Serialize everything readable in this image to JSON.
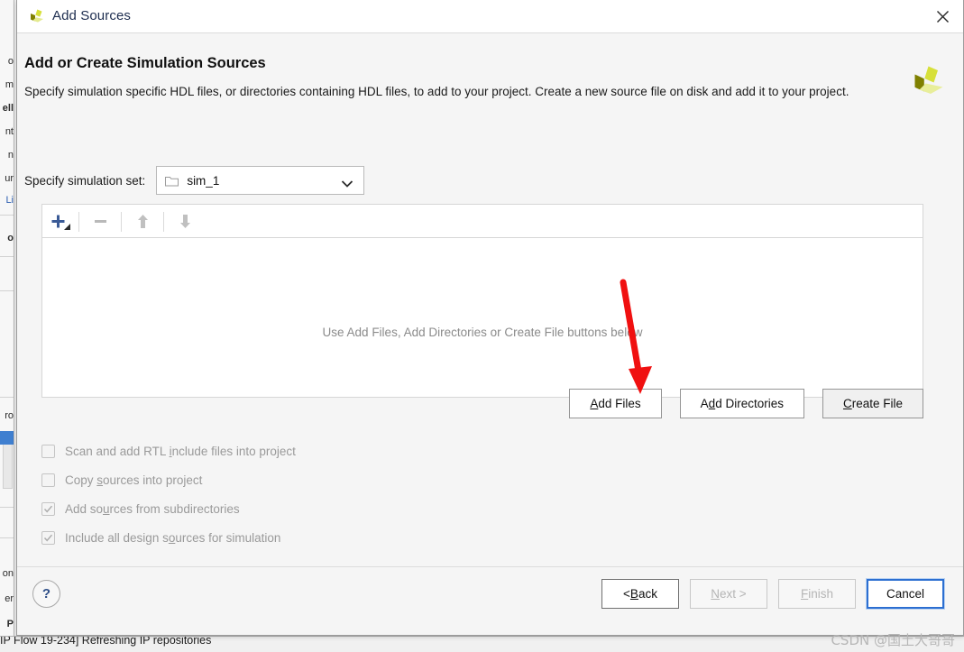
{
  "dialog": {
    "title": "Add Sources",
    "title_icon": "xilinx-logo-icon",
    "close_icon": "close-icon",
    "brand_logo": "amd-xilinx-logo"
  },
  "header": {
    "page_title": "Add or Create Simulation Sources",
    "description": "Specify simulation specific HDL files, or directories containing HDL files, to add to your project. Create a new source file on disk and add it to your project."
  },
  "sim_set": {
    "label": "Specify simulation set:",
    "value": "sim_1",
    "folder_icon": "folder-icon",
    "caret_icon": "chevron-down-icon",
    "options": [
      "sim_1"
    ]
  },
  "toolbar": {
    "buttons": [
      {
        "name": "add-sources-button",
        "icon": "plus-icon",
        "enabled": true,
        "has_dropdown": true
      },
      {
        "name": "remove-sources-button",
        "icon": "minus-icon",
        "enabled": false
      },
      {
        "name": "move-up-button",
        "icon": "arrow-up-icon",
        "enabled": false
      },
      {
        "name": "move-down-button",
        "icon": "arrow-down-icon",
        "enabled": false
      }
    ]
  },
  "source_list": {
    "empty_hint": "Use Add Files, Add Directories or Create File buttons below",
    "items": []
  },
  "source_buttons": [
    {
      "name": "add-files-button",
      "pre": "",
      "mnemonic": "A",
      "post": "dd Files",
      "hover": false
    },
    {
      "name": "add-directories-button",
      "pre": "A",
      "mnemonic": "d",
      "post": "d Directories",
      "hover": false
    },
    {
      "name": "create-file-button",
      "pre": "",
      "mnemonic": "C",
      "post": "reate File",
      "hover": true
    }
  ],
  "options": [
    {
      "name": "scan-rtl-include-checkbox",
      "pre": "Scan and add RTL ",
      "mnemonic": "i",
      "post": "nclude files into project",
      "checked": false,
      "enabled": false
    },
    {
      "name": "copy-sources-checkbox",
      "pre": "Copy ",
      "mnemonic": "s",
      "post": "ources into project",
      "checked": false,
      "enabled": false
    },
    {
      "name": "add-subdirectories-checkbox",
      "pre": "Add so",
      "mnemonic": "u",
      "post": "rces from subdirectories",
      "checked": true,
      "enabled": false
    },
    {
      "name": "include-all-design-sources-checkbox",
      "pre": "Include all design s",
      "mnemonic": "o",
      "post": "urces for simulation",
      "checked": true,
      "enabled": false
    }
  ],
  "footer": {
    "help_label": "?",
    "buttons": [
      {
        "name": "back-button",
        "pre": "< ",
        "mnemonic": "B",
        "post": "ack",
        "state": "enabled"
      },
      {
        "name": "next-button",
        "pre": "",
        "mnemonic": "N",
        "post": "ext >",
        "state": "disabled"
      },
      {
        "name": "finish-button",
        "pre": "",
        "mnemonic": "F",
        "post": "inish",
        "state": "disabled"
      },
      {
        "name": "cancel-button",
        "pre": "",
        "mnemonic": "",
        "post": "Cancel",
        "state": "focused"
      }
    ]
  },
  "annotation": {
    "arrow_color": "#f01010",
    "points_to": "create-file-button"
  },
  "background_app": {
    "status_text": "IP Flow 19-234] Refreshing IP repositories",
    "left_fragments": [
      "o",
      "m",
      "ell",
      "nt",
      "n",
      "ur",
      "Li",
      "o",
      "ro",
      "on",
      "er",
      "P"
    ],
    "right_edge_visible": true
  },
  "watermark": {
    "text": "CSDN @国土大哥哥"
  },
  "colors": {
    "dialog_bg": "#f5f5f5",
    "white": "#ffffff",
    "accent_blue": "#2c6fd1",
    "plus_blue": "#3a5a96",
    "disabled_grey": "#b5b5b5",
    "arrow_red": "#f01010",
    "logo_olive": "#7f8000",
    "logo_yellow": "#d7e03a",
    "logo_pale": "#e8ee9a"
  }
}
